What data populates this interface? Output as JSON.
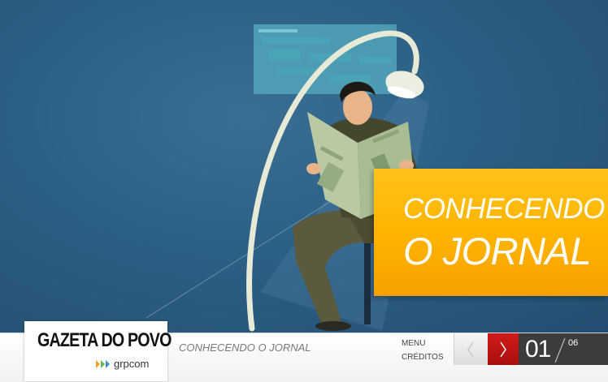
{
  "hero": {
    "title_line1": "CONHECENDO",
    "title_line2": "O JORNAL"
  },
  "footer": {
    "logo_title": "GAZETA DO POVO",
    "logo_subtitle": "grpcom",
    "section_name": "CONHECENDO O JORNAL",
    "menu_label": "MENU",
    "credits_label": "CRÉDITOS",
    "current_page": "01",
    "total_pages": "06"
  },
  "colors": {
    "background": "#2c5f84",
    "accent_orange": "#ffb300",
    "nav_red": "#c01414",
    "pager_dark": "#3c3c3c"
  },
  "icons": {
    "prev": "chevron-left-icon",
    "next": "chevron-right-icon"
  }
}
